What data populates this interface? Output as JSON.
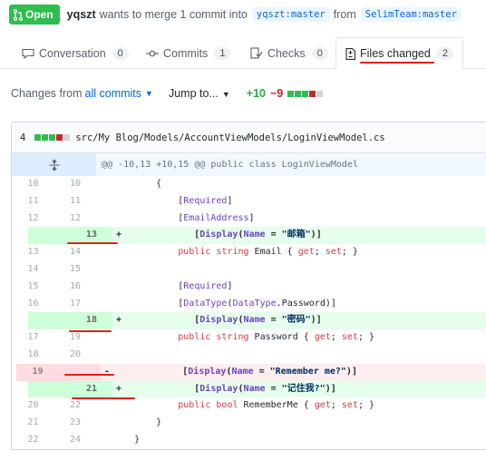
{
  "header": {
    "state": "Open",
    "author": "yqszt",
    "merge_text": "wants to merge 1 commit into",
    "base_branch": "yqszt:master",
    "from_text": "from",
    "head_branch": "SelimTeam:master"
  },
  "tabs": [
    {
      "label": "Conversation",
      "count": "0",
      "icon": "comment-icon"
    },
    {
      "label": "Commits",
      "count": "1",
      "icon": "commit-icon"
    },
    {
      "label": "Checks",
      "count": "0",
      "icon": "checklist-icon"
    },
    {
      "label": "Files changed",
      "count": "2",
      "icon": "file-diff-icon",
      "selected": true
    }
  ],
  "toolbar": {
    "changes_label": "Changes from",
    "changes_link": "all commits",
    "jump_label": "Jump to...",
    "additions": "+10",
    "deletions": "−9"
  },
  "file": {
    "change_count": "4",
    "path": "src/My Blog/Models/AccountViewModels/LoginViewModel.cs",
    "hunk_header": "@@ -10,13 +10,15 @@ public class LoginViewModel"
  },
  "diff_lines": [
    {
      "type": "ctx",
      "old": "10",
      "new": "10",
      "marker": "",
      "code": "        {"
    },
    {
      "type": "ctx",
      "old": "11",
      "new": "11",
      "marker": "",
      "code": "            [Required]"
    },
    {
      "type": "ctx",
      "old": "12",
      "new": "12",
      "marker": "",
      "code": "            [EmailAddress]"
    },
    {
      "type": "add",
      "old": "",
      "new": "13",
      "marker": "+",
      "code": "            [Display(Name = \"邮箱\")]"
    },
    {
      "type": "ctx",
      "old": "13",
      "new": "14",
      "marker": "",
      "code": "            public string Email { get; set; }"
    },
    {
      "type": "ctx",
      "old": "14",
      "new": "15",
      "marker": "",
      "code": ""
    },
    {
      "type": "ctx",
      "old": "15",
      "new": "16",
      "marker": "",
      "code": "            [Required]"
    },
    {
      "type": "ctx",
      "old": "16",
      "new": "17",
      "marker": "",
      "code": "            [DataType(DataType.Password)]"
    },
    {
      "type": "add",
      "old": "",
      "new": "18",
      "marker": "+",
      "code": "            [Display(Name = \"密码\")]"
    },
    {
      "type": "ctx",
      "old": "17",
      "new": "19",
      "marker": "",
      "code": "            public string Password { get; set; }"
    },
    {
      "type": "ctx",
      "old": "18",
      "new": "20",
      "marker": "",
      "code": ""
    },
    {
      "type": "del",
      "old": "19",
      "new": "",
      "marker": "-",
      "code": "            [Display(Name = \"Remember me?\")]"
    },
    {
      "type": "add",
      "old": "",
      "new": "21",
      "marker": "+",
      "code": "            [Display(Name = \"记住我?\")]"
    },
    {
      "type": "ctx",
      "old": "20",
      "new": "22",
      "marker": "",
      "code": "            public bool RememberMe { get; set; }"
    },
    {
      "type": "ctx",
      "old": "21",
      "new": "23",
      "marker": "",
      "code": "        }"
    },
    {
      "type": "ctx",
      "old": "22",
      "new": "24",
      "marker": "",
      "code": "    }"
    }
  ],
  "colors": {
    "open_green": "#2cbe4e",
    "addition": "#28a745",
    "deletion": "#cb2431",
    "annotation_red": "#e0201b"
  }
}
